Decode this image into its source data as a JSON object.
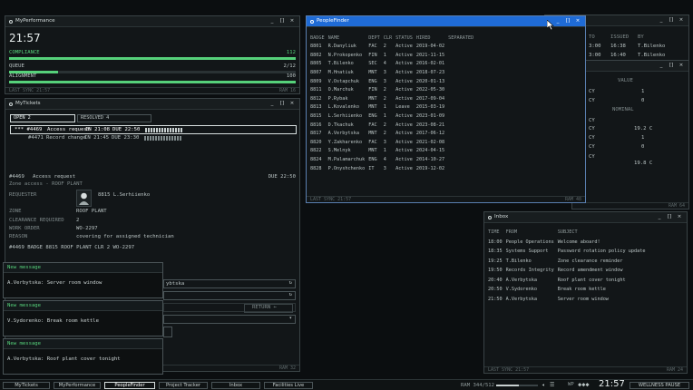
{
  "background_windows": {
    "header_a": "TO",
    "header_b": "ISSUED",
    "header_c": "BY",
    "row1": {
      "a": "3:00",
      "b": "16:38",
      "c": "T.Bilenko"
    },
    "row2": {
      "a": "3:00",
      "b": "16:40",
      "c": "T.Bilenko"
    },
    "value_label": "VALUE",
    "nominal_label": "NOMINAL",
    "cy_rows": [
      "CY",
      "CY",
      "CY",
      "CY",
      "CY",
      "CY",
      "CY"
    ],
    "values": [
      "1",
      "0",
      "19.2 C",
      "1",
      "0",
      "19.8 C"
    ],
    "status_a": "RAM 64",
    "status_b": "x"
  },
  "my_performance": {
    "title": "MyPerformance",
    "time": "21:57",
    "compliance_label": "COMPLIANCE",
    "compliance_value": "112",
    "compliance_progress": 1.0,
    "queue_label": "QUEUE",
    "queue_value": "2/12",
    "queue_progress": 0.17,
    "alignment_label": "ALIGNMENT",
    "alignment_value": "100",
    "alignment_progress": 1.0,
    "status_left": "LAST SYNC 21:57",
    "status_right": "RAM 16"
  },
  "my_tickets": {
    "title": "MyTickets",
    "tab_open": "OPEN 2",
    "tab_resolved": "RESOLVED 4",
    "tickets": [
      {
        "prefix": "*** #4469",
        "name": "Access request",
        "in": "IN 21:08",
        "due": "DUE 22:50"
      },
      {
        "prefix": "#4471",
        "name": "Record change",
        "in": "IN 21:45",
        "due": "DUE 23:30"
      }
    ],
    "detail_id": "#4469",
    "detail_name": "Access request",
    "detail_due": "DUE 22:50",
    "detail_sub": "Zone access - ROOF PLANT",
    "requester_label": "REQUESTER",
    "requester_value": "8815 L.Serhiienko",
    "zone_label": "ZONE",
    "zone_value": "ROOF PLANT",
    "clearance_label": "CLEARANCE REQUIRED",
    "clearance_value": "2",
    "work_order_label": "WORK ORDER",
    "work_order_value": "WO-2297",
    "reason_label": "REASON",
    "reason_value": "covering for assigned technician",
    "command": "#4469 BADGE 8815 ROOF PLANT CLR 2 WO-2297",
    "field_value": "ybtska",
    "return_label": "RETURN ←",
    "status_right": "RAM 32"
  },
  "people_finder": {
    "title": "PeopleFinder",
    "columns": [
      "BADGE",
      "NAME",
      "DEPT",
      "CLR",
      "STATUS",
      "HIRED",
      "SEPARATED"
    ],
    "rows": [
      [
        "8801",
        "R.Danyliuk",
        "FAC",
        "2",
        "Active",
        "2019-04-02",
        ""
      ],
      [
        "8802",
        "N.Prokopenko",
        "FIN",
        "1",
        "Active",
        "2021-11-15",
        ""
      ],
      [
        "8805",
        "T.Bilenko",
        "SEC",
        "4",
        "Active",
        "2016-02-01",
        ""
      ],
      [
        "8807",
        "M.Hnatiuk",
        "MNT",
        "3",
        "Active",
        "2018-07-23",
        ""
      ],
      [
        "8809",
        "V.Ostapchuk",
        "ENG",
        "3",
        "Active",
        "2020-01-13",
        ""
      ],
      [
        "8811",
        "O.Marchuk",
        "FIN",
        "2",
        "Active",
        "2022-05-30",
        ""
      ],
      [
        "8812",
        "P.Rybak",
        "MNT",
        "2",
        "Active",
        "2017-09-04",
        ""
      ],
      [
        "8813",
        "L.Kovalenko",
        "MNT",
        "1",
        "Leave",
        "2015-03-19",
        ""
      ],
      [
        "8815",
        "L.Serhiienko",
        "ENG",
        "1",
        "Active",
        "2023-01-09",
        ""
      ],
      [
        "8816",
        "D.Tkachuk",
        "FAC",
        "2",
        "Active",
        "2023-08-21",
        ""
      ],
      [
        "8817",
        "A.Verbytska",
        "MNT",
        "2",
        "Active",
        "2017-06-12",
        ""
      ],
      [
        "8820",
        "Y.Zakharenko",
        "FAC",
        "3",
        "Active",
        "2021-02-08",
        ""
      ],
      [
        "8822",
        "S.Melnyk",
        "MNT",
        "1",
        "Active",
        "2024-04-15",
        ""
      ],
      [
        "8824",
        "M.Palamarchuk",
        "ENG",
        "4",
        "Active",
        "2014-10-27",
        ""
      ],
      [
        "8828",
        "P.Onyshchenko",
        "IT",
        "3",
        "Active",
        "2019-12-02",
        ""
      ]
    ],
    "status_left": "LAST SYNC 21:57",
    "status_right": "RAM 48"
  },
  "inbox": {
    "title": "Inbox",
    "columns": [
      "TIME",
      "FROM",
      "SUBJECT"
    ],
    "rows": [
      [
        "18:00",
        "People Operations",
        "Welcome aboard!"
      ],
      [
        "18:35",
        "Systems Support",
        "Password rotation policy update"
      ],
      [
        "19:25",
        "T.Bilenko",
        "Zone clearance reminder"
      ],
      [
        "19:50",
        "Records Integrity",
        "Record amendment window"
      ],
      [
        "20:40",
        "A.Verbytska",
        "Roof plant cover tonight"
      ],
      [
        "20:50",
        "V.Sydorenko",
        "Break room kettle"
      ],
      [
        "21:50",
        "A.Verbytska",
        "Server room window"
      ]
    ],
    "status_left": "LAST SYNC 21:57",
    "status_right": "RAM 24"
  },
  "toasts": [
    {
      "header": "New message",
      "body": "A.Verbytska: Server room window"
    },
    {
      "header": "New message",
      "body": "V.Sydorenko: Break room kettle"
    },
    {
      "header": "New message",
      "body": "A.Verbytska: Roof plant cover tonight"
    }
  ],
  "taskbar": {
    "items": [
      "MyTickets",
      "MyPerformance",
      "PeopleFinder",
      "Project Tracker",
      "Inbox",
      "Facilities Live"
    ],
    "active_index": 2,
    "ram": "RAM 344/512",
    "volume_level": 0.55,
    "wp": "WP",
    "clock": "21:57",
    "wellness": "WELLNESS PAUSE"
  }
}
